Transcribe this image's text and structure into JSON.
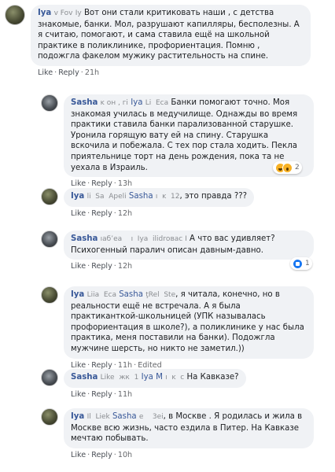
{
  "comments": [
    {
      "author": "Iya",
      "ghost_tag": "v Fov",
      "ghost_tag2": "Iy",
      "text": "Вот они стали критиковать наши , с детства знакомые, банки. Мол, разрушают капилляры, бесполезны. А я считаю, помогают, и сама ставила ещё на школьной практике в поликлинике, профориентация. Помню , подожгла факелом мужику растительность на спине.",
      "like": "Like",
      "reply": "Reply",
      "time": "21h"
    },
    {
      "author": "Sasha",
      "ghost_tag": "ĸ он , гі",
      "mention": "Iya",
      "ghost_tag2": "Li  Еса",
      "text": "Банки помогают точно. Моя знакомая училась в медучилище. Однажды во время практики ставила банки парализованной старушке. Уронила горящую вату ей на спину. Старушка вскочила и побежала. С тех пор стала ходить. Пекла приятельнице торт на день рождения, пока та не уехала в Израиль.",
      "like": "Like",
      "reply": "Reply",
      "time": "13h",
      "reaction_count": "2"
    },
    {
      "author": "Iya",
      "ghost_tag": "li  Sa  Ареli",
      "mention": "Sasha",
      "ghost_tag2": "ı  ĸ  12",
      "text": ", это правда ???",
      "like": "Like",
      "reply": "Reply",
      "time": "12h"
    },
    {
      "author": "Sasha",
      "ghost_tag": "ıаб’еа    ı  Iya  ilidrовас I",
      "text": "А что вас удивляет? Психогенный паралич описан давным-давно.",
      "like": "Like",
      "reply": "Reply",
      "time": "12h",
      "reaction_count": "1"
    },
    {
      "author": "Iya",
      "ghost_tag": "Liіа  Еса",
      "mention": "Sasha",
      "ghost_tag2": "ţRel  Ѕtе",
      "text": ", я читала, конечно, но в реальности ещё не встречала. А я была практиканткой-школьницей (УПК называлась профориентация в школе?), а поликлинике у нас была практика, меня поставили на банки). Подожгла мужчине шерсть, но никто не заметил.))",
      "like": "Like",
      "reply": "Reply",
      "time": "11h",
      "edited": "Edited"
    },
    {
      "author": "Sasha",
      "ghost_tag": "Like  жк  1",
      "mention": "Iya M",
      "ghost_tag2": "ı  ĸ  с",
      "text": "На Кавказе?",
      "like": "Like",
      "reply": "Reply",
      "time": "11h"
    },
    {
      "author": "Iya",
      "ghost_tag": "Il  Liеk",
      "mention": "Sasha",
      "ghost_tag2": "е    3еі",
      "text": ", в Москве . Я родилась и жила в Москве всю жизнь, часто ездила в Питер. На Кавказе мечтаю побывать.",
      "like": "Like",
      "reply": "Reply",
      "time": "10h"
    }
  ]
}
